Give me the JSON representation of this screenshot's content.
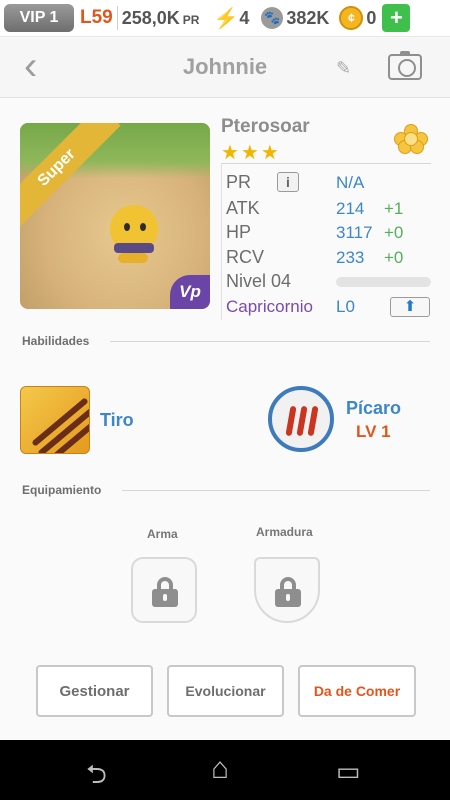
{
  "status_bar": {
    "vip": "VIP 1",
    "level": "L59",
    "pr_value": "258,0K",
    "pr_unit": "PR",
    "energy_glyph": "⚡",
    "energy": "4",
    "paw_glyph": "🐾",
    "food": "382K",
    "coin_glyph": "¢",
    "coins": "0",
    "add_glyph": "+"
  },
  "header": {
    "back_glyph": "‹",
    "name": "Johnnie",
    "edit_glyph": "✎"
  },
  "pet": {
    "rarity_ribbon": "Super",
    "species": "Pterosoar",
    "stars": "★★★",
    "vp_badge": "Vp",
    "stats": {
      "pr_label": "PR",
      "pr_info_glyph": "i",
      "pr_value": "N/A",
      "atk_label": "ATK",
      "atk_value": "214",
      "atk_bonus": "+1",
      "hp_label": "HP",
      "hp_value": "3117",
      "hp_bonus": "+0",
      "rcv_label": "RCV",
      "rcv_value": "233",
      "rcv_bonus": "+0",
      "level_label": "Nivel 04",
      "level_progress": 0.0
    },
    "zodiac": "Capricornio",
    "zodiac_level": "L0",
    "upgrade_glyph": "⬆"
  },
  "sections": {
    "skills_title": "Habilidades",
    "equipment_title": "Equipamiento"
  },
  "skill": {
    "name": "Tiro"
  },
  "trait": {
    "name": "Pícaro",
    "level": "LV 1"
  },
  "equipment": {
    "weapon_label": "Arma",
    "armor_label": "Armadura"
  },
  "actions": {
    "manage": "Gestionar",
    "evolve": "Evolucionar",
    "feed": "Da de Comer"
  },
  "nav": {
    "back_glyph": "⮌",
    "home_glyph": "⌂",
    "recents_glyph": "▭"
  },
  "colors": {
    "accent_blue": "#3c87c8",
    "accent_orange": "#e4551c",
    "zodiac_purple": "#7a4ab0",
    "bonus_green": "#55b05b",
    "star_gold": "#f3b600"
  }
}
